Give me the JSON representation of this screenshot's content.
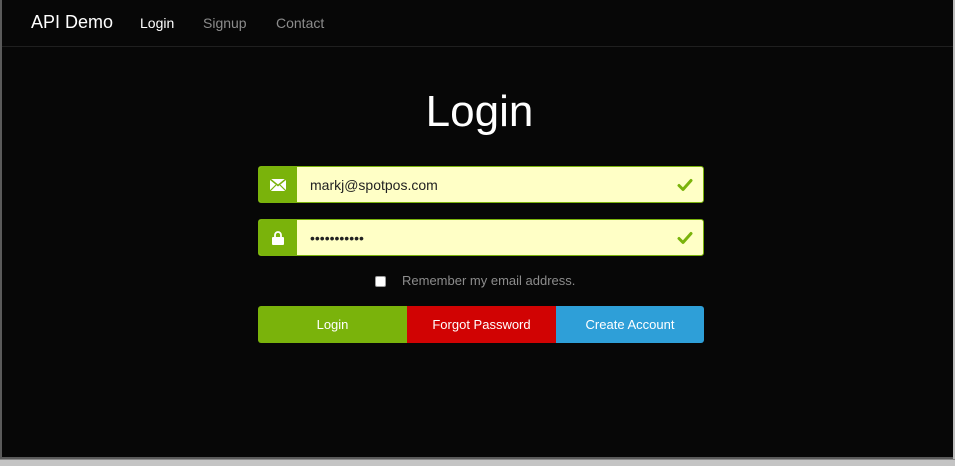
{
  "navbar": {
    "brand": "API Demo",
    "links": [
      {
        "label": "Login",
        "active": true
      },
      {
        "label": "Signup",
        "active": false
      },
      {
        "label": "Contact",
        "active": false
      }
    ]
  },
  "page": {
    "title": "Login"
  },
  "form": {
    "email": {
      "value": "markj@spotpos.com",
      "icon": "envelope-icon",
      "valid_icon": "checkmark-icon"
    },
    "password": {
      "value": "•••••••••••",
      "icon": "lock-icon",
      "valid_icon": "checkmark-icon"
    },
    "remember": {
      "label": "Remember my email address.",
      "checked": false
    },
    "buttons": {
      "login": "Login",
      "forgot": "Forgot Password",
      "create": "Create Account"
    }
  },
  "colors": {
    "background": "#070707",
    "accent_green": "#7ab30b",
    "danger_red": "#d10303",
    "info_blue": "#2e9fd8",
    "input_bg": "#ffffc6"
  }
}
